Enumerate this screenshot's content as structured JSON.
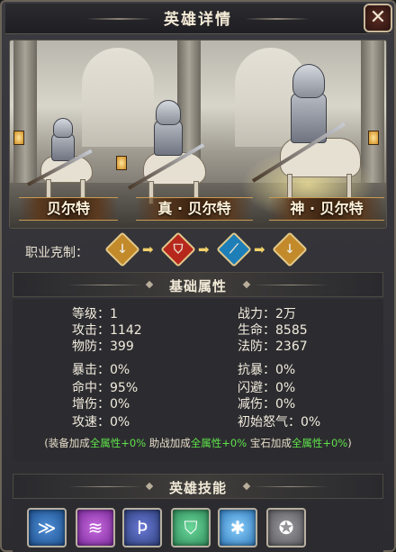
{
  "window": {
    "title": "英雄详情",
    "close_glyph": "✕"
  },
  "heroes": [
    {
      "name": "贝尔特"
    },
    {
      "name": "真 · 贝尔特"
    },
    {
      "name": "神 · 贝尔特"
    }
  ],
  "class_counter": {
    "label": "职业克制：",
    "icons": [
      {
        "icon": "lance-class-icon",
        "glyph": "↓",
        "color": "#c28a2a"
      },
      {
        "icon": "shield-class-icon",
        "glyph": "⛉",
        "color": "#b7281c"
      },
      {
        "icon": "staff-class-icon",
        "glyph": "⟋",
        "color": "#1e7fb8"
      },
      {
        "icon": "lance-class-icon",
        "glyph": "↓",
        "color": "#c28a2a"
      }
    ]
  },
  "base_stats": {
    "title": "基础属性",
    "left": [
      "等级：1",
      "攻击：1142",
      "物防：399",
      "暴击：0%",
      "命中：95%",
      "增伤：0%",
      "攻速：0%"
    ],
    "right": [
      "战力：2万",
      "生命：8585",
      "法防：2367",
      "抗暴：0%",
      "闪避：0%",
      "减伤：0%",
      "初始怒气：0%"
    ],
    "bonus": {
      "open": "(装备加成",
      "equip_value": "全属性+0%",
      "assist_label": " 助战加成",
      "assist_value": "全属性+0%",
      "gem_label": " 宝石加成",
      "gem_value": "全属性+0%",
      "close": ")"
    }
  },
  "skills": {
    "title": "英雄技能",
    "items": [
      {
        "icon": "charge-skill-icon",
        "glyph": "≫",
        "color": "#1d4f8c"
      },
      {
        "icon": "slash-skill-icon",
        "glyph": "≋",
        "color": "#7a2a9a"
      },
      {
        "icon": "rune-skill-icon",
        "glyph": "Ϸ",
        "color": "#2d3f7a"
      },
      {
        "icon": "shield-skill-icon",
        "glyph": "⛉",
        "color": "#2f8a5a"
      },
      {
        "icon": "ice-skill-icon",
        "glyph": "✱",
        "color": "#2f78b8"
      },
      {
        "icon": "pentagram-skill-icon",
        "glyph": "✪",
        "color": "#5a5a5e"
      }
    ]
  }
}
